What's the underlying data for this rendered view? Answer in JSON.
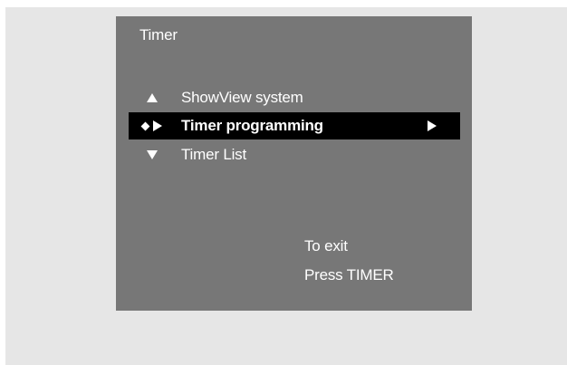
{
  "screen": {
    "title": "Timer",
    "menu": {
      "items": [
        {
          "label": "ShowView system",
          "marker": "up-triangle-icon"
        },
        {
          "label": "Timer programming",
          "marker": "diamond-right-triangle-icon",
          "selected": true,
          "submenu_arrow": "right-triangle-icon"
        },
        {
          "label": "Timer List",
          "marker": "down-triangle-icon"
        }
      ]
    },
    "exit_hint": {
      "line1": "To exit",
      "line2": "Press TIMER"
    }
  },
  "colors": {
    "outer_background": "#e6e6e6",
    "screen_background": "#777777",
    "selected_background": "#000000",
    "text": "#ffffff"
  }
}
